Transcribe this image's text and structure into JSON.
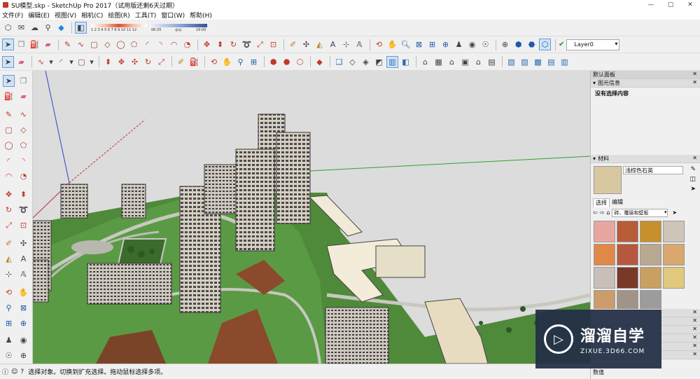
{
  "window": {
    "title": "SU模型.skp - SketchUp Pro 2017（试用版还剩6天过期）",
    "minimize": "—",
    "maximize": "▢",
    "close": "✕"
  },
  "menu": [
    "文件(F)",
    "编辑(E)",
    "视图(V)",
    "相机(C)",
    "绘图(R)",
    "工具(T)",
    "窗口(W)",
    "帮助(H)"
  ],
  "shadows": {
    "month_ticks": "1 2 3 4 5 6 7 8 9 10 11 12",
    "time_start": "06:35",
    "time_mid": "中午",
    "time_end": "19:00"
  },
  "layer": {
    "label": "Layer0",
    "color": "#2e8b2e"
  },
  "tray": {
    "title": "默认面板",
    "entity_info": {
      "header": "图元信息",
      "text": "没有选择内容"
    },
    "materials": {
      "header": "材料",
      "name": "浅棕色石英",
      "tab_select": "选择",
      "tab_edit": "编辑",
      "collection": "砖、覆层和壁板",
      "swatches": [
        "#e8a6a0",
        "#b85c38",
        "#c8902c",
        "#cfc4b8",
        "#e08848",
        "#b65840",
        "#b8a890",
        "#d8a86c",
        "#c8c0b8",
        "#7a3828",
        "#c8a060",
        "#e0c87c",
        "#cc9c6c",
        "#a09488",
        "#9c9c9c"
      ]
    },
    "bottom_label": "数值"
  },
  "status_text": "选择对象。切换到扩充选择。拖动鼠标选择多项。",
  "watermark": {
    "title": "溜溜自学",
    "url": "ZIXUE.3D66.COM"
  },
  "toolbar_icons": {
    "row1": [
      "cube-icon",
      "mail-icon",
      "cloud-icon",
      "link-icon",
      "component-icon",
      "eraser-icon"
    ],
    "row2": [
      "select-icon",
      "eraser-icon",
      "pencil-icon",
      "line-icon",
      "rectangle-icon",
      "circle-icon",
      "arc-icon",
      "pie-icon"
    ],
    "row3": [
      "select-icon",
      "eraser-icon",
      "freehand-icon",
      "arc-icon",
      "rectangle-icon",
      "pushpull-icon",
      "move-icon",
      "rotate-icon"
    ]
  }
}
